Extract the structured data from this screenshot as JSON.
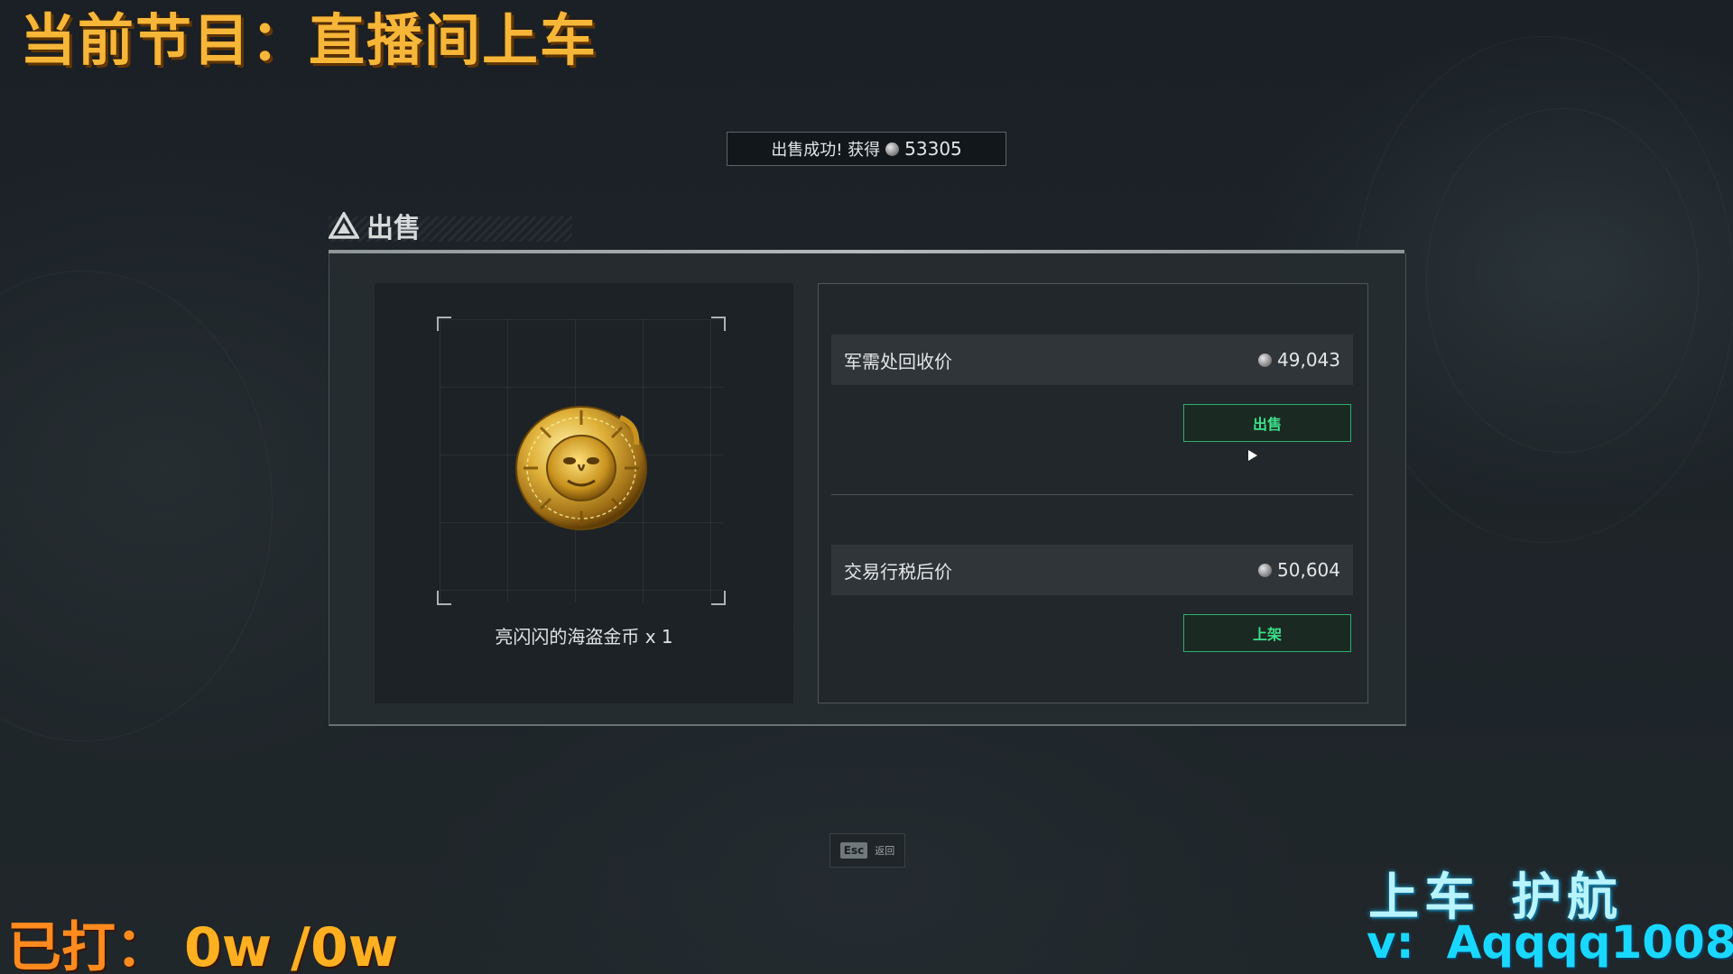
{
  "overlay": {
    "title": "当前节目：直播间上车",
    "count_label": "已打：",
    "count_value": "0w /0w",
    "promo_line1_a": "上车",
    "promo_line1_b": "护航",
    "promo_line2_prefix": "v:",
    "promo_line2_id": "Aqqqq1008"
  },
  "toast": {
    "text": "出售成功! 获得",
    "amount": "53305",
    "icon": "silver-coin-icon"
  },
  "panel": {
    "title": "出售",
    "title_icon": "triangle-logo-icon"
  },
  "item": {
    "name": "亮闪闪的海盗金币 x 1",
    "icon": "pirate-gold-coin-icon"
  },
  "prices": {
    "recycle_label": "军需处回收价",
    "recycle_value": "49,043",
    "sell_button": "出售",
    "trade_label": "交易行税后价",
    "trade_value": "50,604",
    "list_button": "上架"
  },
  "esc_hint": {
    "key": "Esc",
    "label": "返回"
  },
  "colors": {
    "accent_green": "#3de08a",
    "overlay_orange": "#f6b638",
    "overlay_cyan": "#19d8ff"
  }
}
